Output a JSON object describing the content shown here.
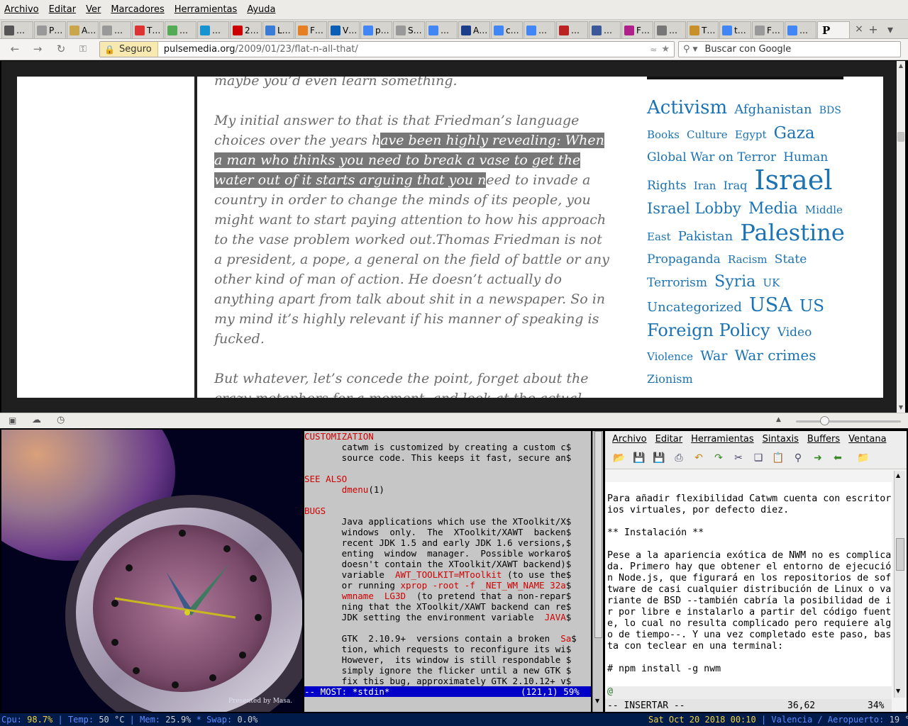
{
  "menubar": [
    "Archivo",
    "Editar",
    "Ver",
    "Marcadores",
    "Herramientas",
    "Ayuda"
  ],
  "tabs": [
    {
      "label": "…",
      "icon": "pocket-icon",
      "color": "#555"
    },
    {
      "label": "P…",
      "icon": "page-icon",
      "color": "#999"
    },
    {
      "label": "A…",
      "icon": "goodreads-icon",
      "color": "#c9a64b"
    },
    {
      "label": "…",
      "icon": "page-icon",
      "color": "#999"
    },
    {
      "label": "T…",
      "icon": "tomato-icon",
      "color": "#d33"
    },
    {
      "label": "…",
      "icon": "turtle-icon",
      "color": "#5a5"
    },
    {
      "label": "…",
      "icon": "arch-icon",
      "color": "#1793d1"
    },
    {
      "label": "2…",
      "icon": "red-icon",
      "color": "#c00"
    },
    {
      "label": "L…",
      "icon": "ds-icon",
      "color": "#3a7bd5"
    },
    {
      "label": "F…",
      "icon": "diamond-icon",
      "color": "#e67e22"
    },
    {
      "label": "V…",
      "icon": "debian-icon",
      "color": "#0a5fb4"
    },
    {
      "label": "p…",
      "icon": "google-icon",
      "color": "#4285f4"
    },
    {
      "label": "S…",
      "icon": "page-icon",
      "color": "#999"
    },
    {
      "label": "…",
      "icon": "google-icon",
      "color": "#4285f4"
    },
    {
      "label": "A…",
      "icon": "number-icon",
      "color": "#1d3f8a"
    },
    {
      "label": "c…",
      "icon": "google-icon",
      "color": "#4285f4"
    },
    {
      "label": "…",
      "icon": "google-icon",
      "color": "#4285f4"
    },
    {
      "label": "…",
      "icon": "x-icon",
      "color": "#b22"
    },
    {
      "label": "…",
      "icon": "facebook-icon",
      "color": "#3b5998"
    },
    {
      "label": "F…",
      "icon": "stripes-icon",
      "color": "#b0208a"
    },
    {
      "label": "…",
      "icon": "wizard-icon",
      "color": "#777"
    },
    {
      "label": "T…",
      "icon": "taco-icon",
      "color": "#c8902b"
    },
    {
      "label": "t…",
      "icon": "google-icon",
      "color": "#4285f4"
    },
    {
      "label": "F…",
      "icon": "page-icon",
      "color": "#999"
    },
    {
      "label": "…",
      "icon": "google-icon",
      "color": "#4285f4"
    }
  ],
  "active_tab": {
    "label": "P",
    "icon": "pulse-icon"
  },
  "nav": {
    "secure_label": "Seguro",
    "url_host": "pulsemedia.org",
    "url_path": "/2009/01/23/flat-n-all-that/",
    "search_placeholder": "Buscar con Google"
  },
  "article": {
    "p0": "maybe you’d even learn something.",
    "p1_before": "My initial answer to that is that Friedman’s language choices over the years h",
    "p1_highlight": "ave been highly revealing: When a man who thinks you need to break a vase to get the water out of it starts arguing that you n",
    "p1_after": "eed to invade a country in order to change the minds of its people, you might want to start paying attention to how his approach to the vase problem worked out.Thomas Friedman is not a president, a pope, a general on the field of battle or any other kind of man of action. He doesn’t actually do anything apart from talk about shit in a newspaper. So in my mind it’s highly relevant if his manner of speaking is fucked.",
    "p2": "But whatever, let’s concede the point, forget about the crazy metaphors for a moment, and look at the actual content of Hot, Flat and Crowded. Many people have rightly seen this"
  },
  "tags": [
    {
      "t": "Activism",
      "s": 26
    },
    {
      "t": "Afghanistan",
      "s": 18
    },
    {
      "t": "BDS",
      "s": 14
    },
    {
      "t": "Books",
      "s": 15
    },
    {
      "t": "Culture",
      "s": 15
    },
    {
      "t": "Egypt",
      "s": 15
    },
    {
      "t": "Gaza",
      "s": 23
    },
    {
      "t": "Global War on Terror",
      "s": 17
    },
    {
      "t": "Human Rights",
      "s": 17
    },
    {
      "t": "Iran",
      "s": 15
    },
    {
      "t": "Iraq",
      "s": 16
    },
    {
      "t": "Israel",
      "s": 38
    },
    {
      "t": "Israel Lobby",
      "s": 21
    },
    {
      "t": "Media",
      "s": 22
    },
    {
      "t": "Middle East",
      "s": 15
    },
    {
      "t": "Pakistan",
      "s": 18
    },
    {
      "t": "Palestine",
      "s": 32
    },
    {
      "t": "Propaganda",
      "s": 17
    },
    {
      "t": "Racism",
      "s": 15
    },
    {
      "t": "State Terrorism",
      "s": 17
    },
    {
      "t": "Syria",
      "s": 22
    },
    {
      "t": "UK",
      "s": 15
    },
    {
      "t": "Uncategorized",
      "s": 18
    },
    {
      "t": "USA",
      "s": 27
    },
    {
      "t": "US",
      "s": 23
    },
    {
      "t": "Foreign Policy",
      "s": 24
    },
    {
      "t": "Video",
      "s": 17
    },
    {
      "t": "Violence",
      "s": 15
    },
    {
      "t": "War",
      "s": 19
    },
    {
      "t": "War crimes",
      "s": 20
    },
    {
      "t": "Zionism",
      "s": 16
    }
  ],
  "clock": {
    "credit": "Presented by Masa."
  },
  "terminal": {
    "lines": [
      [
        {
          "t": "CUSTOMIZATION",
          "c": "red"
        }
      ],
      [
        {
          "t": "       catwm is customized by creating a custom c$"
        }
      ],
      [
        {
          "t": "       source code. This keeps it fast, secure an$"
        }
      ],
      [
        {
          "t": ""
        }
      ],
      [
        {
          "t": "SEE ALSO",
          "c": "red"
        }
      ],
      [
        {
          "t": "       "
        },
        {
          "t": "dmenu",
          "c": "red"
        },
        {
          "t": "(1)"
        }
      ],
      [
        {
          "t": ""
        }
      ],
      [
        {
          "t": "BUGS",
          "c": "red"
        }
      ],
      [
        {
          "t": "       Java applications which use the XToolkit/X$"
        }
      ],
      [
        {
          "t": "       windows  only.  The  XToolkit/XAWT  backen$"
        }
      ],
      [
        {
          "t": "       recent JDK 1.5 and early JDK 1.6 versions,$"
        }
      ],
      [
        {
          "t": "       enting  window  manager.  Possible workaro$"
        }
      ],
      [
        {
          "t": "       doesn't contain the XToolkit/XAWT backend)$"
        }
      ],
      [
        {
          "t": "       variable  "
        },
        {
          "t": "AWT_TOOLKIT=MToolkit",
          "c": "red"
        },
        {
          "t": " (to use the$"
        }
      ],
      [
        {
          "t": "       or running "
        },
        {
          "t": "xprop -root -f _NET_WM_NAME 32a",
          "c": "red"
        },
        {
          "t": "$"
        }
      ],
      [
        {
          "t": "       "
        },
        {
          "t": "wmname  LG3D",
          "c": "red"
        },
        {
          "t": "  (to pretend that a non-repar$"
        }
      ],
      [
        {
          "t": "       ning that the XToolkit/XAWT backend can re$"
        }
      ],
      [
        {
          "t": "       JDK setting the environment variable  "
        },
        {
          "t": "JAVA",
          "c": "red"
        },
        {
          "t": "$"
        }
      ],
      [
        {
          "t": ""
        }
      ],
      [
        {
          "t": "       GTK  2.10.9+  versions contain a broken  "
        },
        {
          "t": "Sa",
          "c": "red"
        },
        {
          "t": "$"
        }
      ],
      [
        {
          "t": "       tion, which requests to reconfigure its wi$"
        }
      ],
      [
        {
          "t": "       However,  its window is still respondable $"
        }
      ],
      [
        {
          "t": "       simply ignore the flicker until a new GTK $"
        }
      ],
      [
        {
          "t": "       fix this bug, approximately GTK 2.10.12+ v$"
        }
      ]
    ],
    "status_left": "-- MOST: *stdin*",
    "status_right": "(121,1) 59%"
  },
  "editor": {
    "menu": [
      "Archivo",
      "Editar",
      "Herramientas",
      "Sintaxis",
      "Buffers",
      "Ventana"
    ],
    "lines": [
      "",
      "Para añadir flexibilidad Catwm cuenta con escritor",
      "ios virtuales, por defecto diez.",
      "",
      "** Instalación **",
      "",
      "Pese a la apariencia exótica de NWM no es complica",
      "da. Primero hay que obtener el entorno de ejecució",
      "n Node.js, que figurará en los repositorios de sof",
      "tware de casi cualquier distribución de Linux o va",
      "riante de BSD --también cabría la posibilidad de i",
      "r por libre e instalarlo a partir del código fuent",
      "e, lo cual no resulta complicado pero requiere alg",
      "o de tiempo--. Y una vez completado este paso, bas",
      "ta con teclear en una terminal:",
      "",
      "# npm install -g nwm",
      "",
      "@",
      "@"
    ],
    "mode": "-- INSERTAR --",
    "position": "36,62",
    "percent": "34%"
  },
  "panel": {
    "cpu_label": "Cpu:",
    "cpu": "98.7%",
    "temp_label": "Temp:",
    "temp": "50 °C",
    "mem_label": "Mem:",
    "mem": "25.9%",
    "swap_label": "Swap:",
    "swap": "0.0%",
    "datetime": "Sat Oct 20 2018 00:10",
    "location": "Valencia / Aeropuerto:",
    "weather": "19 °C"
  },
  "colors": {
    "link": "#1b73b3",
    "panel_bg": "#001a4a",
    "panel_text": "#5b8cff",
    "panel_value": "#f3d33a",
    "term_status": "#0000c8"
  }
}
